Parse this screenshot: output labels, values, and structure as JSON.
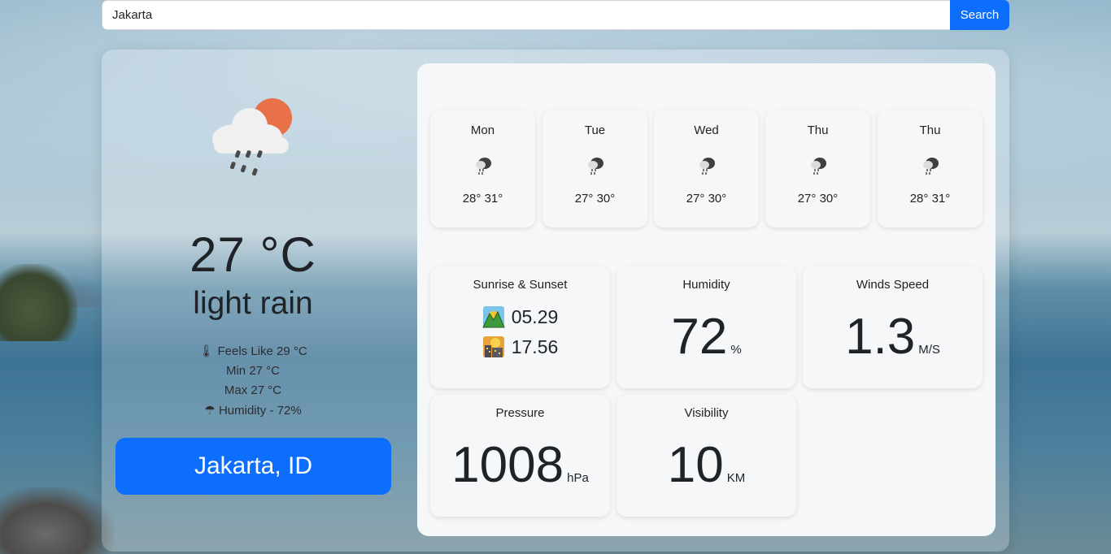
{
  "search": {
    "value": "Jakarta",
    "button_label": "Search"
  },
  "current": {
    "temperature": "27 °C",
    "description": "light rain",
    "feels_like": "Feels Like 29 °C",
    "min": "Min 27 °C",
    "max": "Max 27 °C",
    "humidity": "Humidity - 72%",
    "location": "Jakarta, ID",
    "icon": "cloud-sun-rain-icon"
  },
  "forecast": [
    {
      "day": "Mon",
      "temps": "28° 31°",
      "icon": "rain-cloud-icon"
    },
    {
      "day": "Tue",
      "temps": "27° 30°",
      "icon": "rain-cloud-icon"
    },
    {
      "day": "Wed",
      "temps": "27° 30°",
      "icon": "rain-cloud-icon"
    },
    {
      "day": "Thu",
      "temps": "27° 30°",
      "icon": "rain-cloud-icon"
    },
    {
      "day": "Thu",
      "temps": "28° 31°",
      "icon": "rain-cloud-icon"
    }
  ],
  "stats": {
    "sun": {
      "title": "Sunrise & Sunset",
      "sunrise": "05.29",
      "sunset": "17.56"
    },
    "humidity": {
      "title": "Humidity",
      "value": "72",
      "unit": "%"
    },
    "wind": {
      "title": "Winds Speed",
      "value": "1.3",
      "unit": "M/S"
    },
    "pressure": {
      "title": "Pressure",
      "value": "1008",
      "unit": "hPa"
    },
    "visibility": {
      "title": "Visibility",
      "value": "10",
      "unit": "KM"
    }
  },
  "colors": {
    "accent": "#0d6efd",
    "sun": "#e8714a",
    "panel": "#f5f7f9"
  }
}
